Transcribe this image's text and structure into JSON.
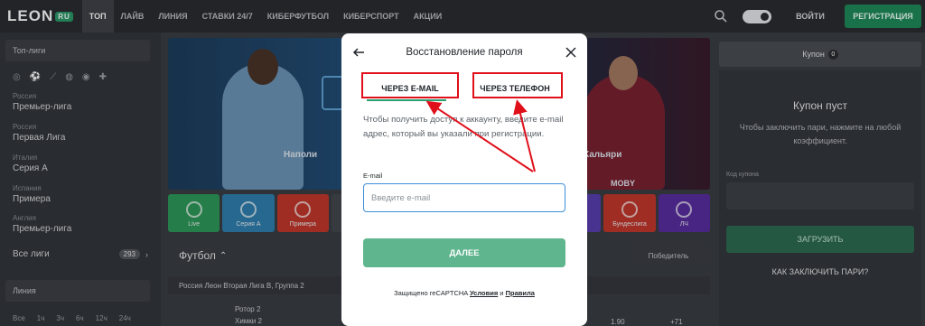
{
  "brand": {
    "logo": "LEON",
    "logo_tag": "RU"
  },
  "nav": {
    "items": [
      {
        "label": "ТОП",
        "active": true
      },
      {
        "label": "ЛАЙВ"
      },
      {
        "label": "ЛИНИЯ"
      },
      {
        "label": "СТАВКИ 24/7"
      },
      {
        "label": "КИБЕРФУТБОЛ"
      },
      {
        "label": "КИБЕРСПОРТ"
      },
      {
        "label": "АКЦИИ"
      }
    ],
    "login": "ВОЙТИ",
    "register": "РЕГИСТРАЦИЯ"
  },
  "sidebar": {
    "top_leagues": "Топ-лиги",
    "leagues": [
      {
        "country": "Россия",
        "name": "Премьер-лига"
      },
      {
        "country": "Россия",
        "name": "Первая Лига"
      },
      {
        "country": "Италия",
        "name": "Серия А"
      },
      {
        "country": "Испания",
        "name": "Примера"
      },
      {
        "country": "Англия",
        "name": "Премьер-лига"
      }
    ],
    "all_leagues": "Все лиги",
    "all_leagues_count": "293",
    "line": "Линия",
    "time_filters": [
      "Все",
      "1ч",
      "3ч",
      "6ч",
      "12ч",
      "24ч"
    ]
  },
  "banner": {
    "team_left": "Наполи",
    "team_right": "Кальяри",
    "brand_text": "MOBY"
  },
  "categories": [
    {
      "label": "Live",
      "color": "#2e9a5a"
    },
    {
      "label": "Серия А",
      "color": "#2f7fb0"
    },
    {
      "label": "Примера",
      "color": "#c2372d"
    },
    {
      "label": "",
      "color": "#44474d"
    },
    {
      "label": "",
      "color": "#44474d"
    },
    {
      "label": "",
      "color": "#44474d"
    },
    {
      "label": "",
      "color": "#44474d"
    },
    {
      "label": "",
      "color": "#5a3fb0"
    },
    {
      "label": "Бундеслига",
      "color": "#c2372d"
    },
    {
      "label": "ЛЧ",
      "color": "#5a2ea0"
    }
  ],
  "section": {
    "title": "Футбол",
    "filter": "Победитель",
    "match_group": "Россия Леон Вторая Лига В, Группа 2",
    "team1": "Ротор 2",
    "team2": "Химки 2",
    "odd1": "1.90",
    "odd2": "+71"
  },
  "coupon": {
    "tab_label": "Купон",
    "tab_count": "0",
    "empty_title": "Купон пуст",
    "empty_text": "Чтобы заключить пари, нажмите на любой коэффициент.",
    "code_label": "Код купона",
    "load_button": "ЗАГРУЗИТЬ",
    "how_link": "КАК ЗАКЛЮЧИТЬ ПАРИ?"
  },
  "modal": {
    "title": "Восстановление пароля",
    "tab_email": "ЧЕРЕЗ E-MAIL",
    "tab_phone": "ЧЕРЕЗ ТЕЛЕФОН",
    "description": "Чтобы получить доступ к аккаунту, введите e-mail адрес, который вы указали при регистрации.",
    "email_label": "E-mail",
    "email_value": "",
    "email_placeholder": "Введите e-mail",
    "submit": "ДАЛЕЕ",
    "recaptcha_prefix": "Защищено reCAPTCHA",
    "recaptcha_terms": "Условия",
    "recaptcha_and": "и",
    "recaptcha_privacy": "Правила"
  },
  "colors": {
    "highlight": "#e0101b",
    "accent_green": "#5fb58e",
    "input_focus": "#3d8fd8",
    "register_green": "#1f8a5b"
  }
}
